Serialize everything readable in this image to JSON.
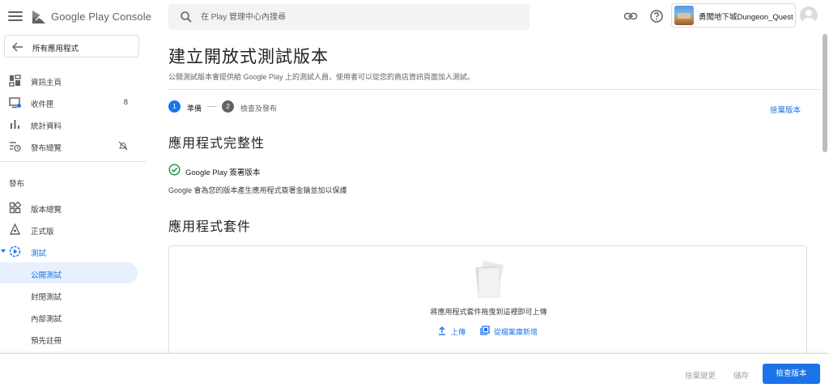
{
  "header": {
    "brand": "Google Play Console",
    "search_placeholder": "在 Play 管理中心內搜尋",
    "app_name": "勇闖地下城Dungeon_Quest"
  },
  "sidebar": {
    "back_label": "所有應用程式",
    "top_items": [
      {
        "label": "資訊主頁",
        "icon": "dashboard-icon"
      },
      {
        "label": "收件匣",
        "icon": "inbox-icon",
        "count": "8"
      },
      {
        "label": "統計資料",
        "icon": "bar-chart-icon"
      },
      {
        "label": "發布總覽",
        "icon": "publishing-overview-icon"
      }
    ],
    "release_section": "發布",
    "release_items": [
      {
        "label": "版本總覽",
        "icon": "releases-overview-icon"
      },
      {
        "label": "正式版",
        "icon": "production-icon"
      },
      {
        "label": "測試",
        "icon": "testing-icon"
      },
      {
        "label": "公開測試",
        "active": true
      },
      {
        "label": "封閉測試"
      },
      {
        "label": "內部測試"
      },
      {
        "label": "預先註冊"
      }
    ]
  },
  "main": {
    "title": "建立開放式測試版本",
    "description": "公開測試版本會提供給 Google Play 上的測試人員，使用者可以從您的商店資訊頁面加入測試。",
    "steps": [
      {
        "number": "1",
        "label": "準備"
      },
      {
        "number": "2",
        "label": "檢查及發布"
      }
    ],
    "discard_label": "捨棄版本",
    "integrity_heading": "應用程式完整性",
    "signing_label": "Google Play 簽署版本",
    "signing_note": "Google 會為您的版本產生應用程式簽署金鑰並加以保護",
    "bundles_heading": "應用程式套件",
    "drop_text": "將應用程式套件拖曳到這裡即可上傳",
    "upload_label": "上傳",
    "library_label": "從檔案庫新增"
  },
  "footer": {
    "discard_changes": "捨棄變更",
    "save": "儲存",
    "review": "檢查版本"
  },
  "colors": {
    "accent": "#1a73e8",
    "success": "#1e8e3e",
    "step_inactive": "#5f6368"
  }
}
